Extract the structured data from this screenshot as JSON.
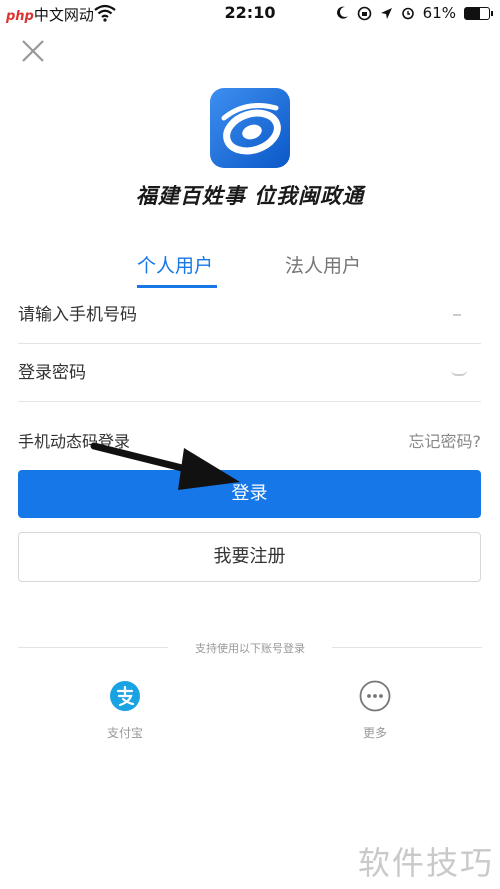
{
  "status_bar": {
    "carrier_brand": "php",
    "carrier_text": "中文网",
    "carrier_suffix": "动",
    "time": "22:10",
    "battery": "61%",
    "battery_level": 0.61
  },
  "header": {
    "slogan": "福建百姓事 位我闽政通"
  },
  "tabs": [
    {
      "label": "个人用户",
      "active": true
    },
    {
      "label": "法人用户",
      "active": false
    }
  ],
  "form": {
    "phone_placeholder": "请输入手机号码",
    "password_placeholder": "登录密码",
    "sms_login_label": "手机动态码登录",
    "forgot_label": "忘记密码?",
    "login_label": "登录",
    "register_label": "我要注册"
  },
  "other_login": {
    "divider_text": "支持使用以下账号登录",
    "options": [
      {
        "label": "支付宝",
        "icon": "alipay-icon"
      },
      {
        "label": "更多",
        "icon": "more-icon"
      }
    ]
  },
  "watermark": "软件技巧",
  "colors": {
    "accent": "#1677e8",
    "alipay": "#1aa3e2"
  }
}
